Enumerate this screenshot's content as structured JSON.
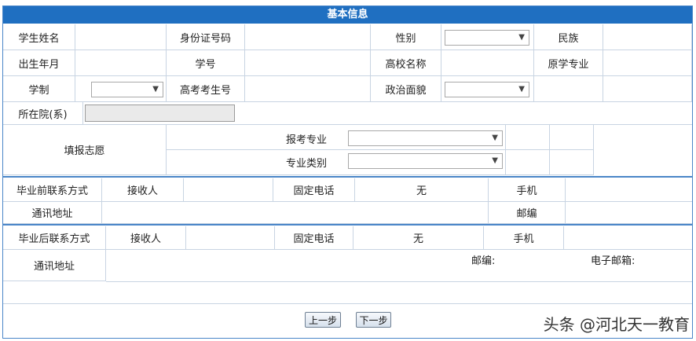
{
  "header": {
    "title": "基本信息"
  },
  "row1": {
    "name_label": "学生姓名",
    "id_label": "身份证号码",
    "gender_label": "性别",
    "ethnic_label": "民族"
  },
  "row2": {
    "birth_label": "出生年月",
    "student_no_label": "学号",
    "college_label": "高校名称",
    "orig_major_label": "原学专业"
  },
  "row3": {
    "duration_label": "学制",
    "exam_no_label": "高考考生号",
    "political_label": "政治面貌"
  },
  "row4": {
    "dept_label": "所在院(系)"
  },
  "application": {
    "title": "填报志愿",
    "major_label": "报考专业",
    "category_label": "专业类别"
  },
  "before": {
    "title": "毕业前联系方式",
    "receiver_label": "接收人",
    "phone_label": "固定电话",
    "phone_value": "无",
    "mobile_label": "手机",
    "address_label": "通讯地址",
    "postcode_label": "邮编"
  },
  "after": {
    "title": "毕业后联系方式",
    "receiver_label": "接收人",
    "phone_label": "固定电话",
    "phone_value": "无",
    "mobile_label": "手机",
    "address_label": "通讯地址",
    "postcode_label": "邮编:",
    "email_label": "电子邮箱:"
  },
  "buttons": {
    "prev": "上一步",
    "next": "下一步"
  },
  "watermark": "头条 @河北天一教育"
}
